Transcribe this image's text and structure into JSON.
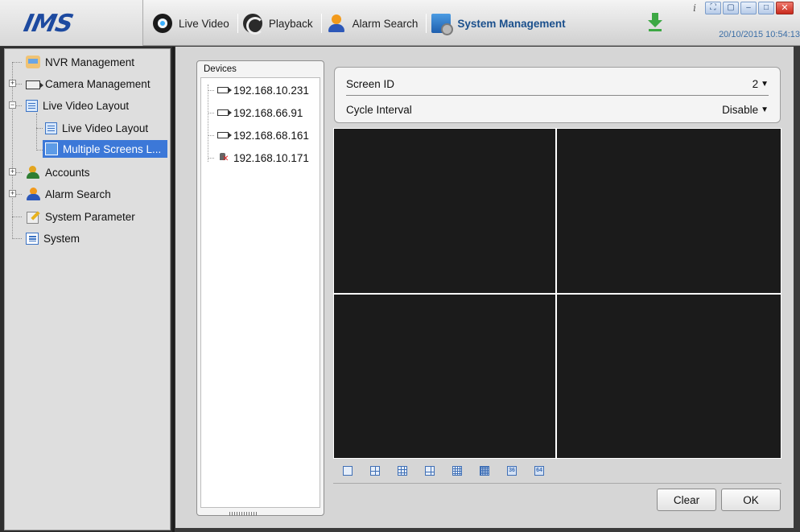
{
  "app": {
    "logo": "IMS",
    "datetime": "20/10/2015 10:54:13"
  },
  "nav": [
    {
      "label": "Live Video",
      "icon": "eye-icon",
      "active": false
    },
    {
      "label": "Playback",
      "icon": "playback-icon",
      "active": false
    },
    {
      "label": "Alarm Search",
      "icon": "alarm-user-icon",
      "active": false
    },
    {
      "label": "System Management",
      "icon": "system-monitor-icon",
      "active": true
    }
  ],
  "window_controls": {
    "info": "i"
  },
  "tree": [
    {
      "label": "NVR Management",
      "icon": "nvr-icon",
      "expandable": false
    },
    {
      "label": "Camera Management",
      "icon": "camera-icon",
      "expandable": true
    },
    {
      "label": "Live Video Layout",
      "icon": "layout-icon",
      "expandable": true,
      "expanded": true
    },
    {
      "label": "Live Video Layout",
      "icon": "layout-icon",
      "child": true
    },
    {
      "label": "Multiple Screens L...",
      "icon": "multi-screen-icon",
      "child": true,
      "selected": true
    },
    {
      "label": "Accounts",
      "icon": "accounts-icon",
      "expandable": true
    },
    {
      "label": "Alarm Search",
      "icon": "alarm-user-icon",
      "expandable": true
    },
    {
      "label": "System Parameter",
      "icon": "parameter-icon",
      "expandable": false
    },
    {
      "label": "System",
      "icon": "system-icon",
      "expandable": false
    }
  ],
  "devices": {
    "title": "Devices",
    "items": [
      {
        "label": "192.168.10.231",
        "status": "online"
      },
      {
        "label": "192.168.66.91",
        "status": "online"
      },
      {
        "label": "192.168.68.161",
        "status": "online"
      },
      {
        "label": "192.168.10.171",
        "status": "offline"
      }
    ]
  },
  "settings": {
    "screen_id_label": "Screen ID",
    "screen_id_value": "2",
    "cycle_interval_label": "Cycle Interval",
    "cycle_interval_value": "Disable"
  },
  "layout_buttons": [
    "1",
    "4",
    "9",
    "6",
    "16",
    "25",
    "36",
    "64"
  ],
  "layout_button_text": {
    "l36": "36",
    "l64": "64"
  },
  "buttons": {
    "clear": "Clear",
    "ok": "OK"
  },
  "colors": {
    "accent": "#3c78d8",
    "active_nav": "#1a4f8c",
    "video_bg": "#1b1b1b"
  }
}
